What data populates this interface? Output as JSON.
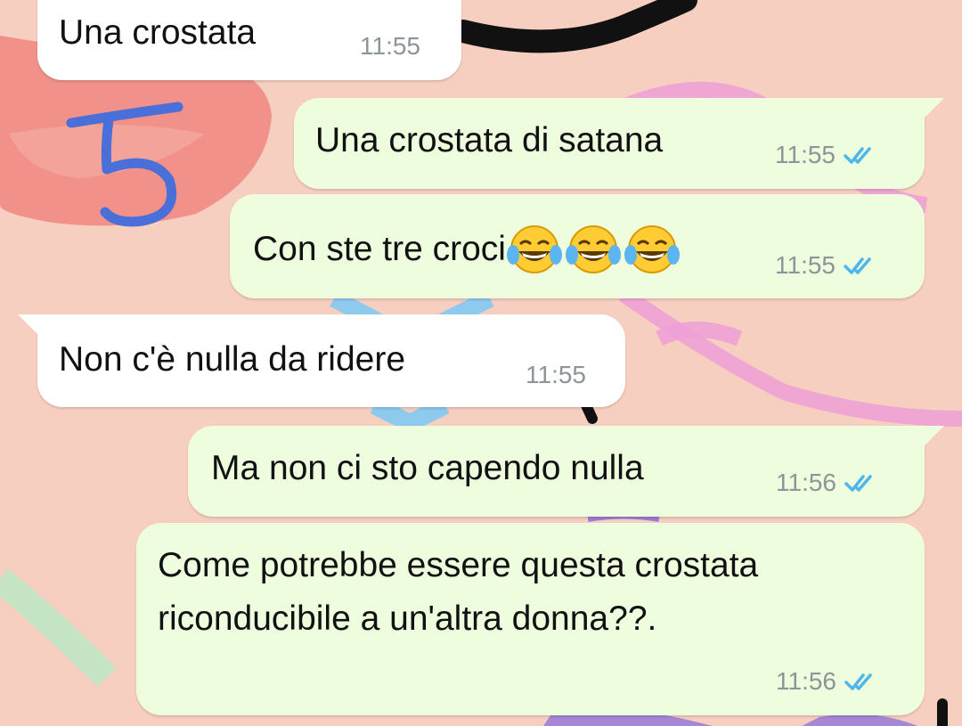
{
  "chat": {
    "messages": [
      {
        "direction": "incoming",
        "text": "Una crostata",
        "time": "11:55"
      },
      {
        "direction": "outgoing",
        "text": "Una crostata di satana",
        "time": "11:55",
        "status": "read"
      },
      {
        "direction": "outgoing",
        "text": "Con ste tre croci",
        "emoji": "face-with-tears-of-joy",
        "emoji_count": 3,
        "time": "11:55",
        "status": "read"
      },
      {
        "direction": "incoming",
        "text": "Non c'è nulla da ridere",
        "time": "11:55"
      },
      {
        "direction": "outgoing",
        "text": "Ma non ci sto capendo nulla",
        "time": "11:56",
        "status": "read"
      },
      {
        "direction": "outgoing",
        "text_lines": [
          "Come potrebbe essere questa crostata",
          "riconducibile a un'altra donna??."
        ],
        "time": "11:56",
        "status": "read"
      }
    ]
  },
  "annotation": {
    "text": "5",
    "color": "#4a6fd8"
  },
  "colors": {
    "wallpaper": "#f7cfc0",
    "incoming_bubble": "#ffffff",
    "outgoing_bubble": "#eefdde",
    "read_ticks": "#4fb6ec",
    "timestamp": "#8c9598"
  },
  "icons": {
    "read_receipt": "double-check-icon",
    "emoji": "face-with-tears-of-joy-icon"
  }
}
